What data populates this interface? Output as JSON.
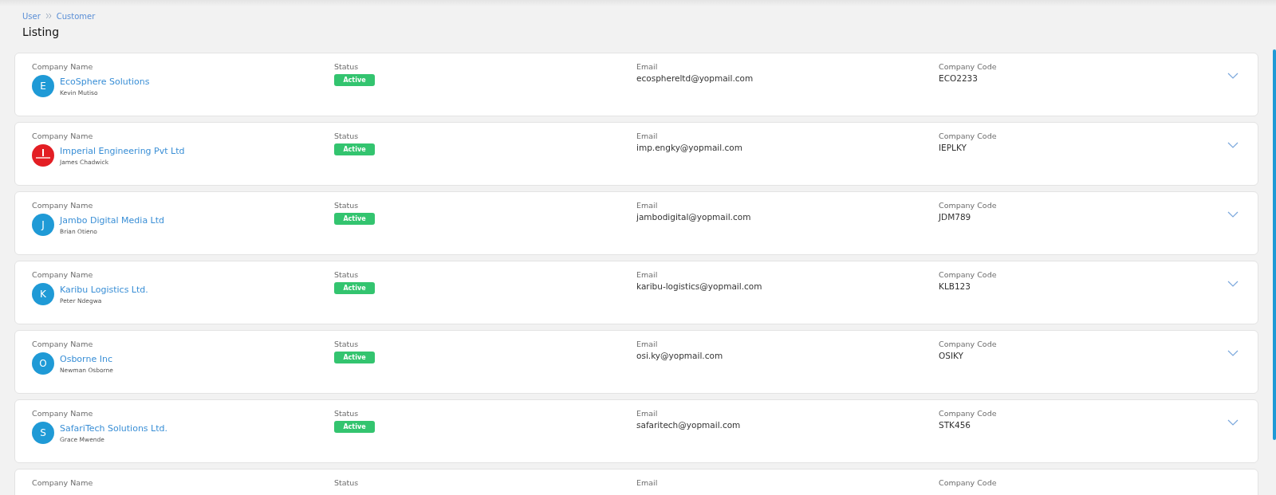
{
  "breadcrumb": [
    "User",
    "Customer"
  ],
  "page_title": "Listing",
  "customers": [
    {
      "labels": [
        "Company Name",
        "Status",
        "Email",
        "Company Code"
      ],
      "avatar": {
        "kind": "letter",
        "letter": "E"
      },
      "company": "EcoSphere Solutions",
      "contact": "Kevin Mutiso",
      "status": "Active",
      "email": "ecosphereltd@yopmail.com",
      "code": "ECO2233"
    },
    {
      "labels": [
        "Company Name",
        "Status",
        "Email",
        "Company Code"
      ],
      "avatar": {
        "kind": "logo"
      },
      "company": "Imperial Engineering Pvt Ltd",
      "contact": "James Chadwick",
      "status": "Active",
      "email": "imp.engky@yopmail.com",
      "code": "IEPLKY"
    },
    {
      "labels": [
        "Company Name",
        "Status",
        "Email",
        "Company Code"
      ],
      "avatar": {
        "kind": "letter",
        "letter": "J"
      },
      "company": "Jambo Digital Media Ltd",
      "contact": "Brian Otieno",
      "status": "Active",
      "email": "jambodigital@yopmail.com",
      "code": "JDM789"
    },
    {
      "labels": [
        "Company Name",
        "Status",
        "Email",
        "Company Code"
      ],
      "avatar": {
        "kind": "letter",
        "letter": "K"
      },
      "company": "Karibu Logistics Ltd.",
      "contact": "Peter Ndegwa",
      "status": "Active",
      "email": "karibu-logistics@yopmail.com",
      "code": "KLB123"
    },
    {
      "labels": [
        "Company Name",
        "Status",
        "Email",
        "Company Code"
      ],
      "avatar": {
        "kind": "letter",
        "letter": "O"
      },
      "company": "Osborne Inc",
      "contact": "Newman Osborne",
      "status": "Active",
      "email": "osi.ky@yopmail.com",
      "code": "OSIKY"
    },
    {
      "labels": [
        "Company Name",
        "Status",
        "Email",
        "Company Code"
      ],
      "avatar": {
        "kind": "letter",
        "letter": "S"
      },
      "company": "SafariTech Solutions Ltd.",
      "contact": "Grace Mwende",
      "status": "Active",
      "email": "safaritech@yopmail.com",
      "code": "STK456"
    },
    {
      "labels": [
        "Company Name",
        "Status",
        "Email",
        "Company Code"
      ]
    }
  ]
}
